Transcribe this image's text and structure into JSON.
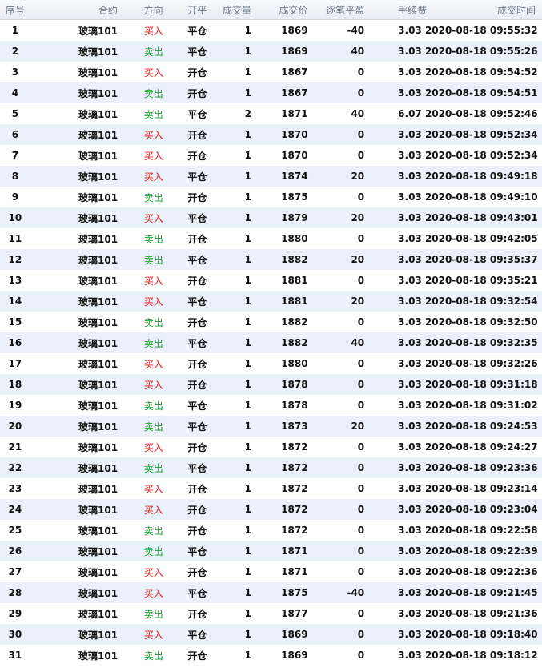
{
  "headers": {
    "seq": "序号",
    "contract": "合约",
    "direction": "方向",
    "openclose": "开平",
    "volume": "成交量",
    "price": "成交价",
    "pnl": "逐笔平盈",
    "fee": "手续费",
    "time": "成交时间"
  },
  "colors": {
    "buy": "#e8191a",
    "sell": "#12a02b",
    "row_alt": "#eaf1fa",
    "header_text": "#6e7a88"
  },
  "rows": [
    {
      "seq": "1",
      "contract": "玻璃101",
      "direction": "买入",
      "dir": "buy",
      "oc": "平仓",
      "vol": "1",
      "price": "1869",
      "pnl": "-40",
      "fee": "3.03",
      "time": "2020-08-18 09:55:32"
    },
    {
      "seq": "2",
      "contract": "玻璃101",
      "direction": "卖出",
      "dir": "sell",
      "oc": "平仓",
      "vol": "1",
      "price": "1869",
      "pnl": "40",
      "fee": "3.03",
      "time": "2020-08-18 09:55:26"
    },
    {
      "seq": "3",
      "contract": "玻璃101",
      "direction": "买入",
      "dir": "buy",
      "oc": "开仓",
      "vol": "1",
      "price": "1867",
      "pnl": "0",
      "fee": "3.03",
      "time": "2020-08-18 09:54:52"
    },
    {
      "seq": "4",
      "contract": "玻璃101",
      "direction": "卖出",
      "dir": "sell",
      "oc": "开仓",
      "vol": "1",
      "price": "1867",
      "pnl": "0",
      "fee": "3.03",
      "time": "2020-08-18 09:54:51"
    },
    {
      "seq": "5",
      "contract": "玻璃101",
      "direction": "卖出",
      "dir": "sell",
      "oc": "平仓",
      "vol": "2",
      "price": "1871",
      "pnl": "40",
      "fee": "6.07",
      "time": "2020-08-18 09:52:46"
    },
    {
      "seq": "6",
      "contract": "玻璃101",
      "direction": "买入",
      "dir": "buy",
      "oc": "开仓",
      "vol": "1",
      "price": "1870",
      "pnl": "0",
      "fee": "3.03",
      "time": "2020-08-18 09:52:34"
    },
    {
      "seq": "7",
      "contract": "玻璃101",
      "direction": "买入",
      "dir": "buy",
      "oc": "开仓",
      "vol": "1",
      "price": "1870",
      "pnl": "0",
      "fee": "3.03",
      "time": "2020-08-18 09:52:34"
    },
    {
      "seq": "8",
      "contract": "玻璃101",
      "direction": "买入",
      "dir": "buy",
      "oc": "平仓",
      "vol": "1",
      "price": "1874",
      "pnl": "20",
      "fee": "3.03",
      "time": "2020-08-18 09:49:18"
    },
    {
      "seq": "9",
      "contract": "玻璃101",
      "direction": "卖出",
      "dir": "sell",
      "oc": "开仓",
      "vol": "1",
      "price": "1875",
      "pnl": "0",
      "fee": "3.03",
      "time": "2020-08-18 09:49:10"
    },
    {
      "seq": "10",
      "contract": "玻璃101",
      "direction": "买入",
      "dir": "buy",
      "oc": "平仓",
      "vol": "1",
      "price": "1879",
      "pnl": "20",
      "fee": "3.03",
      "time": "2020-08-18 09:43:01"
    },
    {
      "seq": "11",
      "contract": "玻璃101",
      "direction": "卖出",
      "dir": "sell",
      "oc": "开仓",
      "vol": "1",
      "price": "1880",
      "pnl": "0",
      "fee": "3.03",
      "time": "2020-08-18 09:42:05"
    },
    {
      "seq": "12",
      "contract": "玻璃101",
      "direction": "卖出",
      "dir": "sell",
      "oc": "平仓",
      "vol": "1",
      "price": "1882",
      "pnl": "20",
      "fee": "3.03",
      "time": "2020-08-18 09:35:37"
    },
    {
      "seq": "13",
      "contract": "玻璃101",
      "direction": "买入",
      "dir": "buy",
      "oc": "开仓",
      "vol": "1",
      "price": "1881",
      "pnl": "0",
      "fee": "3.03",
      "time": "2020-08-18 09:35:21"
    },
    {
      "seq": "14",
      "contract": "玻璃101",
      "direction": "买入",
      "dir": "buy",
      "oc": "平仓",
      "vol": "1",
      "price": "1881",
      "pnl": "20",
      "fee": "3.03",
      "time": "2020-08-18 09:32:54"
    },
    {
      "seq": "15",
      "contract": "玻璃101",
      "direction": "卖出",
      "dir": "sell",
      "oc": "开仓",
      "vol": "1",
      "price": "1882",
      "pnl": "0",
      "fee": "3.03",
      "time": "2020-08-18 09:32:50"
    },
    {
      "seq": "16",
      "contract": "玻璃101",
      "direction": "卖出",
      "dir": "sell",
      "oc": "平仓",
      "vol": "1",
      "price": "1882",
      "pnl": "40",
      "fee": "3.03",
      "time": "2020-08-18 09:32:35"
    },
    {
      "seq": "17",
      "contract": "玻璃101",
      "direction": "买入",
      "dir": "buy",
      "oc": "开仓",
      "vol": "1",
      "price": "1880",
      "pnl": "0",
      "fee": "3.03",
      "time": "2020-08-18 09:32:26"
    },
    {
      "seq": "18",
      "contract": "玻璃101",
      "direction": "买入",
      "dir": "buy",
      "oc": "开仓",
      "vol": "1",
      "price": "1878",
      "pnl": "0",
      "fee": "3.03",
      "time": "2020-08-18 09:31:18"
    },
    {
      "seq": "19",
      "contract": "玻璃101",
      "direction": "卖出",
      "dir": "sell",
      "oc": "平仓",
      "vol": "1",
      "price": "1878",
      "pnl": "0",
      "fee": "3.03",
      "time": "2020-08-18 09:31:02"
    },
    {
      "seq": "20",
      "contract": "玻璃101",
      "direction": "卖出",
      "dir": "sell",
      "oc": "平仓",
      "vol": "1",
      "price": "1873",
      "pnl": "20",
      "fee": "3.03",
      "time": "2020-08-18 09:24:53"
    },
    {
      "seq": "21",
      "contract": "玻璃101",
      "direction": "买入",
      "dir": "buy",
      "oc": "开仓",
      "vol": "1",
      "price": "1872",
      "pnl": "0",
      "fee": "3.03",
      "time": "2020-08-18 09:24:27"
    },
    {
      "seq": "22",
      "contract": "玻璃101",
      "direction": "卖出",
      "dir": "sell",
      "oc": "平仓",
      "vol": "1",
      "price": "1872",
      "pnl": "0",
      "fee": "3.03",
      "time": "2020-08-18 09:23:36"
    },
    {
      "seq": "23",
      "contract": "玻璃101",
      "direction": "买入",
      "dir": "buy",
      "oc": "开仓",
      "vol": "1",
      "price": "1872",
      "pnl": "0",
      "fee": "3.03",
      "time": "2020-08-18 09:23:14"
    },
    {
      "seq": "24",
      "contract": "玻璃101",
      "direction": "买入",
      "dir": "buy",
      "oc": "开仓",
      "vol": "1",
      "price": "1872",
      "pnl": "0",
      "fee": "3.03",
      "time": "2020-08-18 09:23:04"
    },
    {
      "seq": "25",
      "contract": "玻璃101",
      "direction": "卖出",
      "dir": "sell",
      "oc": "开仓",
      "vol": "1",
      "price": "1872",
      "pnl": "0",
      "fee": "3.03",
      "time": "2020-08-18 09:22:58"
    },
    {
      "seq": "26",
      "contract": "玻璃101",
      "direction": "卖出",
      "dir": "sell",
      "oc": "平仓",
      "vol": "1",
      "price": "1871",
      "pnl": "0",
      "fee": "3.03",
      "time": "2020-08-18 09:22:39"
    },
    {
      "seq": "27",
      "contract": "玻璃101",
      "direction": "买入",
      "dir": "buy",
      "oc": "开仓",
      "vol": "1",
      "price": "1871",
      "pnl": "0",
      "fee": "3.03",
      "time": "2020-08-18 09:22:36"
    },
    {
      "seq": "28",
      "contract": "玻璃101",
      "direction": "买入",
      "dir": "buy",
      "oc": "平仓",
      "vol": "1",
      "price": "1875",
      "pnl": "-40",
      "fee": "3.03",
      "time": "2020-08-18 09:21:45"
    },
    {
      "seq": "29",
      "contract": "玻璃101",
      "direction": "卖出",
      "dir": "sell",
      "oc": "开仓",
      "vol": "1",
      "price": "1877",
      "pnl": "0",
      "fee": "3.03",
      "time": "2020-08-18 09:21:36"
    },
    {
      "seq": "30",
      "contract": "玻璃101",
      "direction": "买入",
      "dir": "buy",
      "oc": "平仓",
      "vol": "1",
      "price": "1869",
      "pnl": "0",
      "fee": "3.03",
      "time": "2020-08-18 09:18:40"
    },
    {
      "seq": "31",
      "contract": "玻璃101",
      "direction": "卖出",
      "dir": "sell",
      "oc": "开仓",
      "vol": "1",
      "price": "1869",
      "pnl": "0",
      "fee": "3.03",
      "time": "2020-08-18 09:18:12"
    }
  ]
}
